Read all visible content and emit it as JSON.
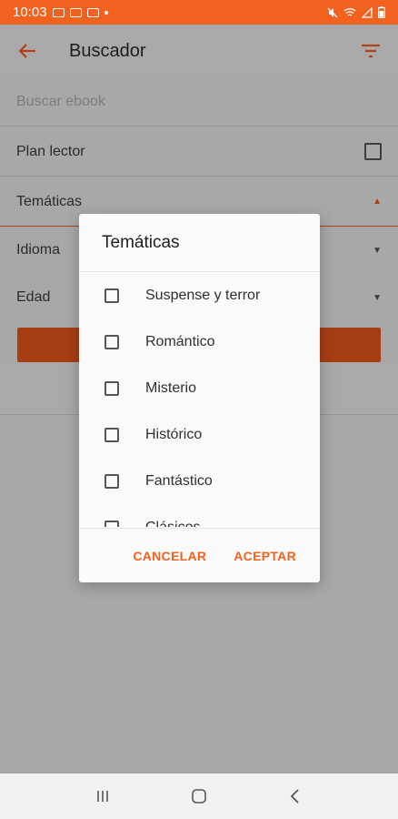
{
  "status_bar": {
    "time": "10:03",
    "colors": {
      "background": "#f2611d"
    }
  },
  "app_bar": {
    "title": "Buscador",
    "back_icon": "arrow-back-icon",
    "filter_icon": "filter-icon"
  },
  "form": {
    "search_placeholder": "Buscar ebook",
    "plan_lector_label": "Plan lector",
    "tematicas_label": "Temáticas",
    "idioma_label": "Idioma",
    "edad_label": "Edad"
  },
  "dialog": {
    "title": "Temáticas",
    "items": [
      {
        "label": "Suspense y terror",
        "checked": false
      },
      {
        "label": "Romántico",
        "checked": false
      },
      {
        "label": "Misterio",
        "checked": false
      },
      {
        "label": "Histórico",
        "checked": false
      },
      {
        "label": "Fantástico",
        "checked": false
      },
      {
        "label": "Clásicos",
        "checked": false
      }
    ],
    "cancel_label": "CANCELAR",
    "accept_label": "ACEPTAR"
  },
  "nav_bar": {
    "recents_icon": "recents-icon",
    "home_icon": "home-icon",
    "back_icon": "nav-back-icon"
  },
  "colors": {
    "accent": "#f2611d",
    "scrim": "#a8a8a8"
  }
}
